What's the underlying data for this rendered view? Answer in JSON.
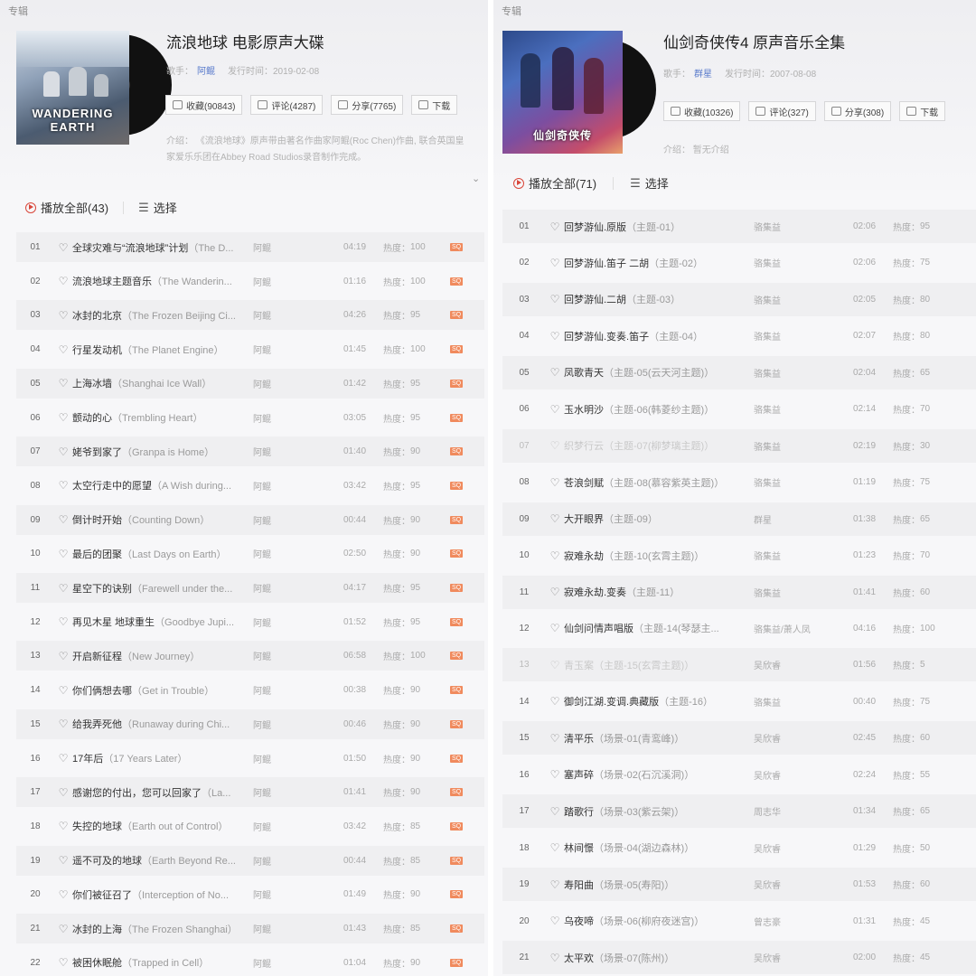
{
  "left": {
    "breadcrumb": "专辑",
    "album_title": "流浪地球 电影原声大碟",
    "artist_label": "歌手：",
    "artist": "阿鲲",
    "release_label": "发行时间：",
    "release_date": "2019-02-08",
    "cover_text": "WANDERING EARTH",
    "buttons": {
      "collect": "收藏(90843)",
      "comment": "评论(4287)",
      "share": "分享(7765)",
      "download": "下载"
    },
    "intro_line1": "介绍： 《流浪地球》原声带由著名作曲家阿鲲(Roc Chen)作曲, 联合英国皇",
    "intro_line2": "家爱乐乐团在Abbey Road Studios录音制作完成。",
    "expand_icon": "chevron-down",
    "play_all": "播放全部(43)",
    "select": "选择",
    "hot_label": "热度：",
    "badge": "SQ",
    "tracks": [
      {
        "num": "01",
        "title": "全球灾难与“流浪地球”计划",
        "sub": "（The D...",
        "artist": "阿鲲",
        "dur": "04:19",
        "hot": "100"
      },
      {
        "num": "02",
        "title": "流浪地球主题音乐",
        "sub": "（The Wanderin...",
        "artist": "阿鲲",
        "dur": "01:16",
        "hot": "100"
      },
      {
        "num": "03",
        "title": "冰封的北京",
        "sub": "（The Frozen Beijing Ci...",
        "artist": "阿鲲",
        "dur": "04:26",
        "hot": "95"
      },
      {
        "num": "04",
        "title": "行星发动机",
        "sub": "（The Planet Engine）",
        "artist": "阿鲲",
        "dur": "01:45",
        "hot": "100"
      },
      {
        "num": "05",
        "title": "上海冰墙",
        "sub": "（Shanghai Ice Wall）",
        "artist": "阿鲲",
        "dur": "01:42",
        "hot": "95"
      },
      {
        "num": "06",
        "title": "颤动的心",
        "sub": "（Trembling Heart）",
        "artist": "阿鲲",
        "dur": "03:05",
        "hot": "95"
      },
      {
        "num": "07",
        "title": "姥爷到家了",
        "sub": "（Granpa is Home）",
        "artist": "阿鲲",
        "dur": "01:40",
        "hot": "90"
      },
      {
        "num": "08",
        "title": "太空行走中的愿望",
        "sub": "（A Wish during...",
        "artist": "阿鲲",
        "dur": "03:42",
        "hot": "95"
      },
      {
        "num": "09",
        "title": "倒计时开始",
        "sub": "（Counting Down）",
        "artist": "阿鲲",
        "dur": "00:44",
        "hot": "90"
      },
      {
        "num": "10",
        "title": "最后的团聚",
        "sub": "（Last Days on Earth）",
        "artist": "阿鲲",
        "dur": "02:50",
        "hot": "90"
      },
      {
        "num": "11",
        "title": "星空下的诀别",
        "sub": "（Farewell under the...",
        "artist": "阿鲲",
        "dur": "04:17",
        "hot": "95"
      },
      {
        "num": "12",
        "title": "再见木星 地球重生",
        "sub": "（Goodbye Jupi...",
        "artist": "阿鲲",
        "dur": "01:52",
        "hot": "95"
      },
      {
        "num": "13",
        "title": "开启新征程",
        "sub": "（New Journey）",
        "artist": "阿鲲",
        "dur": "06:58",
        "hot": "100"
      },
      {
        "num": "14",
        "title": "你们俩想去哪",
        "sub": "（Get in Trouble）",
        "artist": "阿鲲",
        "dur": "00:38",
        "hot": "90"
      },
      {
        "num": "15",
        "title": "给我弄死他",
        "sub": "（Runaway during Chi...",
        "artist": "阿鲲",
        "dur": "00:46",
        "hot": "90"
      },
      {
        "num": "16",
        "title": "17年后",
        "sub": "（17 Years Later）",
        "artist": "阿鲲",
        "dur": "01:50",
        "hot": "90"
      },
      {
        "num": "17",
        "title": "感谢您的付出，您可以回家了",
        "sub": "（La...",
        "artist": "阿鲲",
        "dur": "01:41",
        "hot": "90"
      },
      {
        "num": "18",
        "title": "失控的地球",
        "sub": "（Earth out of Control）",
        "artist": "阿鲲",
        "dur": "03:42",
        "hot": "85"
      },
      {
        "num": "19",
        "title": "遥不可及的地球",
        "sub": "（Earth Beyond Re...",
        "artist": "阿鲲",
        "dur": "00:44",
        "hot": "85"
      },
      {
        "num": "20",
        "title": "你们被征召了",
        "sub": "（Interception of No...",
        "artist": "阿鲲",
        "dur": "01:49",
        "hot": "90"
      },
      {
        "num": "21",
        "title": "冰封的上海",
        "sub": "（The Frozen Shanghai）",
        "artist": "阿鲲",
        "dur": "01:43",
        "hot": "85"
      },
      {
        "num": "22",
        "title": "被困休眠舱",
        "sub": "（Trapped in Cell）",
        "artist": "阿鲲",
        "dur": "01:04",
        "hot": "90"
      }
    ]
  },
  "right": {
    "breadcrumb": "专辑",
    "album_title": "仙剑奇侠传4 原声音乐全集",
    "artist_label": "歌手：",
    "artist": "群星",
    "release_label": "发行时间：",
    "release_date": "2007-08-08",
    "cover_text": "仙剑奇侠传",
    "buttons": {
      "collect": "收藏(10326)",
      "comment": "评论(327)",
      "share": "分享(308)",
      "download": "下载"
    },
    "intro_line1": "介绍： 暂无介绍",
    "play_all": "播放全部(71)",
    "select": "选择",
    "hot_label": "热度：",
    "tracks": [
      {
        "num": "01",
        "title": "回梦游仙.原版",
        "sub": "（主题-01）",
        "artist": "骆集益",
        "dur": "02:06",
        "hot": "95"
      },
      {
        "num": "02",
        "title": "回梦游仙.笛子 二胡",
        "sub": "（主题-02）",
        "artist": "骆集益",
        "dur": "02:06",
        "hot": "75"
      },
      {
        "num": "03",
        "title": "回梦游仙.二胡",
        "sub": "（主题-03）",
        "artist": "骆集益",
        "dur": "02:05",
        "hot": "80"
      },
      {
        "num": "04",
        "title": "回梦游仙.变奏.笛子",
        "sub": "（主题-04）",
        "artist": "骆集益",
        "dur": "02:07",
        "hot": "80"
      },
      {
        "num": "05",
        "title": "凤歌青天",
        "sub": "（主题-05(云天河主题)）",
        "artist": "骆集益",
        "dur": "02:04",
        "hot": "65"
      },
      {
        "num": "06",
        "title": "玉水明沙",
        "sub": "（主题-06(韩菱纱主题)）",
        "artist": "骆集益",
        "dur": "02:14",
        "hot": "70"
      },
      {
        "num": "07",
        "title": "织梦行云",
        "sub": "（主题-07(柳梦璃主题)）",
        "artist": "骆集益",
        "dur": "02:19",
        "hot": "30",
        "faded": true
      },
      {
        "num": "08",
        "title": "苍浪剑赋",
        "sub": "（主题-08(慕容紫英主题)）",
        "artist": "骆集益",
        "dur": "01:19",
        "hot": "75"
      },
      {
        "num": "09",
        "title": "大开眼界",
        "sub": "（主题-09）",
        "artist": "群星",
        "dur": "01:38",
        "hot": "65"
      },
      {
        "num": "10",
        "title": "寂难永劫",
        "sub": "（主题-10(玄霄主题)）",
        "artist": "骆集益",
        "dur": "01:23",
        "hot": "70"
      },
      {
        "num": "11",
        "title": "寂难永劫.变奏",
        "sub": "（主题-11）",
        "artist": "骆集益",
        "dur": "01:41",
        "hot": "60"
      },
      {
        "num": "12",
        "title": "仙剑问情声唱版",
        "sub": "（主题-14(琴瑟主...",
        "artist": "骆集益/萧人凤",
        "dur": "04:16",
        "hot": "100"
      },
      {
        "num": "13",
        "title": "青玉案",
        "sub": "（主题-15(玄霄主题)）",
        "artist": "吴欣睿",
        "dur": "01:56",
        "hot": "5",
        "faded": true
      },
      {
        "num": "14",
        "title": "御剑江湖.变调.典藏版",
        "sub": "（主题-16）",
        "artist": "骆集益",
        "dur": "00:40",
        "hot": "75"
      },
      {
        "num": "15",
        "title": "清平乐",
        "sub": "（场景-01(青鸾峰)）",
        "artist": "吴欣睿",
        "dur": "02:45",
        "hot": "60"
      },
      {
        "num": "16",
        "title": "塞声碎",
        "sub": "（场景-02(石沉溪洞)）",
        "artist": "吴欣睿",
        "dur": "02:24",
        "hot": "55"
      },
      {
        "num": "17",
        "title": "踏歌行",
        "sub": "（场景-03(紫云架)）",
        "artist": "周志华",
        "dur": "01:34",
        "hot": "65"
      },
      {
        "num": "18",
        "title": "林间憬",
        "sub": "（场景-04(湖边森林)）",
        "artist": "吴欣睿",
        "dur": "01:29",
        "hot": "50"
      },
      {
        "num": "19",
        "title": "寿阳曲",
        "sub": "（场景-05(寿阳)）",
        "artist": "吴欣睿",
        "dur": "01:53",
        "hot": "60"
      },
      {
        "num": "20",
        "title": "乌夜啼",
        "sub": "（场景-06(柳府夜迷宫)）",
        "artist": "曾志豪",
        "dur": "01:31",
        "hot": "45"
      },
      {
        "num": "21",
        "title": "太平欢",
        "sub": "（场景-07(陈州)）",
        "artist": "吴欣睿",
        "dur": "02:00",
        "hot": "45"
      }
    ]
  },
  "colors": {
    "accent": "#d9463a",
    "artist_link": "#5b7ccc",
    "sq_badge": "#f08a5d"
  }
}
